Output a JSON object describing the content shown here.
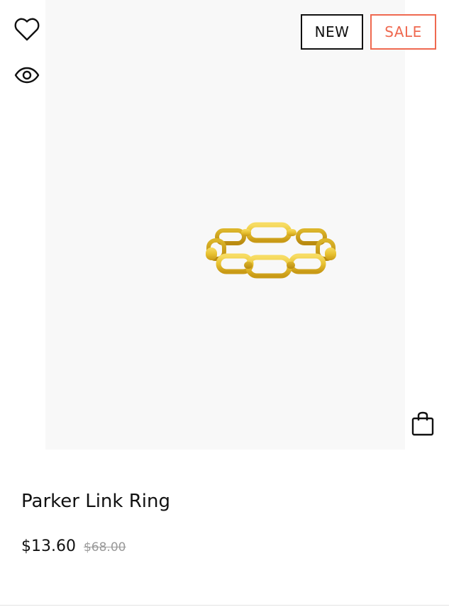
{
  "product": {
    "name": "Parker Link Ring",
    "sale_price": "$13.60",
    "original_price": "$68.00",
    "image_alt": "Parker Link Ring gold chain link ring"
  },
  "badges": {
    "new_label": "NEW",
    "sale_label": "SALE"
  },
  "actions": {
    "wishlist_label": "Add to wishlist",
    "quickview_label": "Quick view",
    "cart_label": "Add to cart"
  },
  "icons": {
    "wishlist": "heart-icon",
    "quickview": "eye-icon",
    "cart": "shopping-bag-icon"
  },
  "colors": {
    "badge_new": "#111111",
    "badge_sale": "#ef6950",
    "image_background": "#f8f8f8",
    "gold": "#e8c232"
  }
}
